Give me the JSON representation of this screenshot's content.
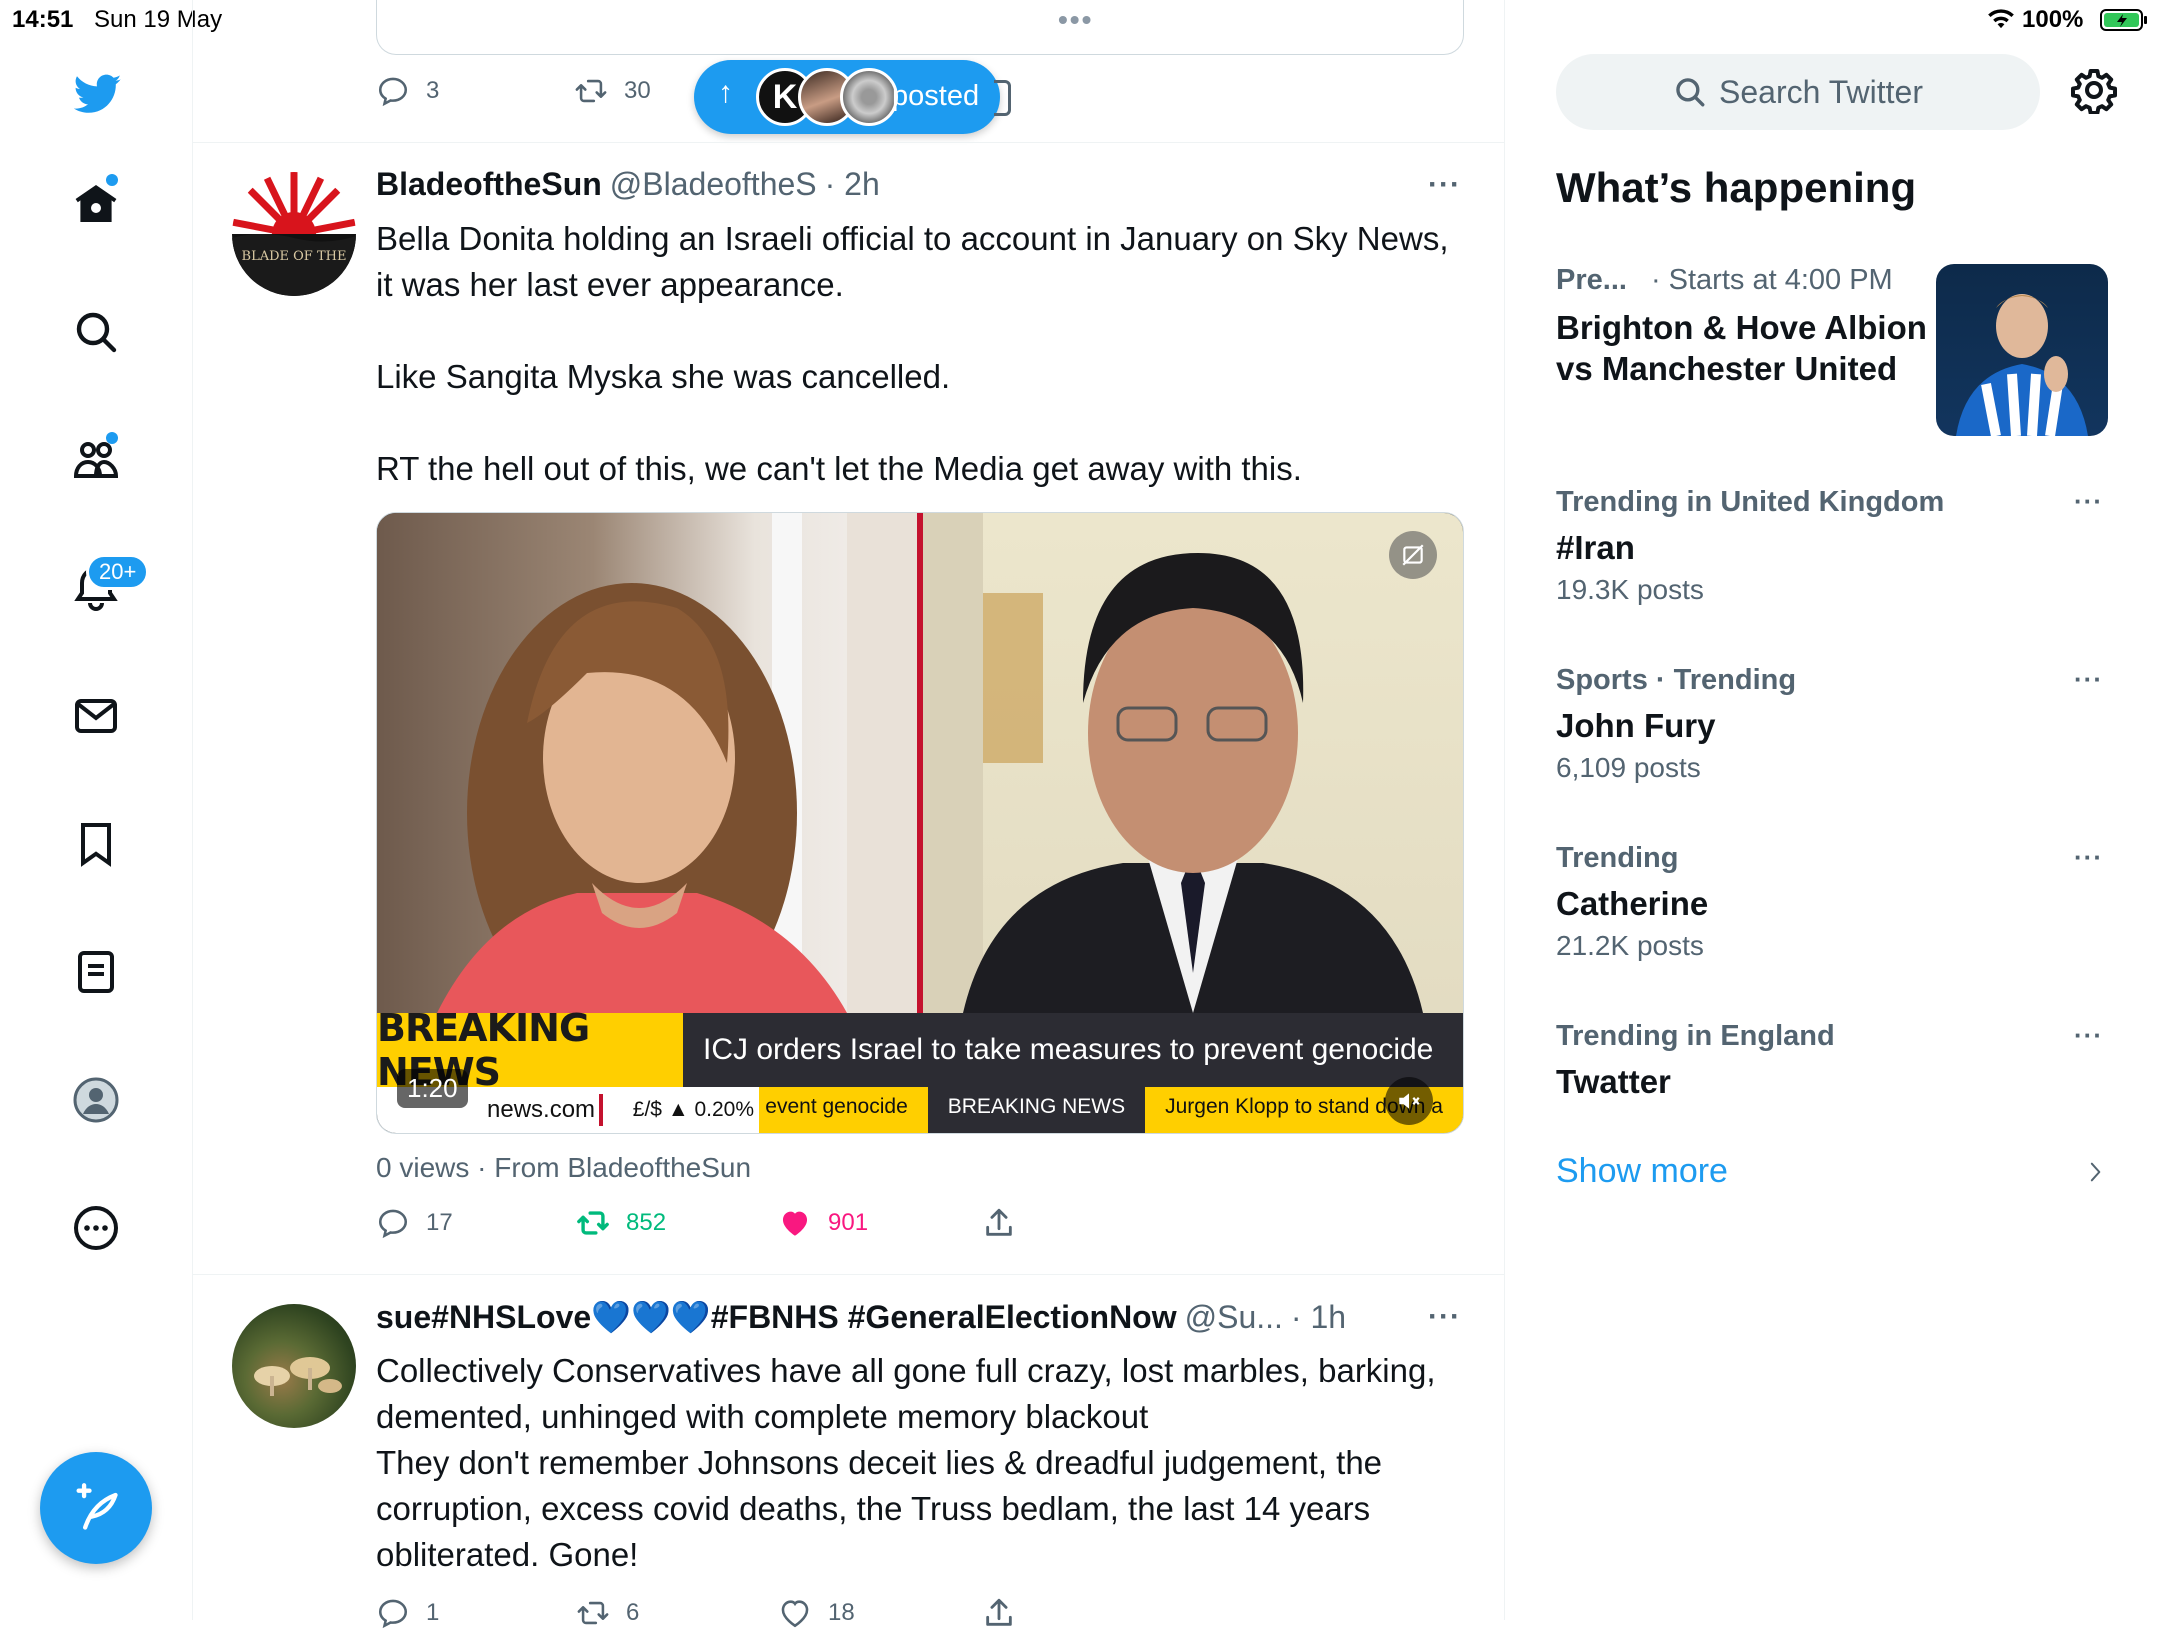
{
  "status_bar": {
    "time": "14:51",
    "date": "Sun 19 May",
    "battery": "100%"
  },
  "nav": {
    "notifications_badge": "20+"
  },
  "pill": {
    "label": "posted",
    "avatar_letter": "K"
  },
  "prev_tweet": {
    "replies": "3",
    "retweets": "30"
  },
  "tweet1": {
    "name": "BladeoftheSun",
    "handle": "@BladeoftheS",
    "time": "· 2h",
    "text": "Bella Donita holding an Israeli official to account in January on Sky News, it was her last ever appearance.\n\nLike Sangita Myska she was cancelled.\n\nRT the hell out of this, we can't let the Media get away with this.",
    "avatar_text": "BLADE OF THE",
    "video": {
      "duration": "1:20",
      "headline_tag": "BREAKING NEWS",
      "headline": "ICJ orders Israel to take measures to prevent genocide",
      "ticker_site": "news.com",
      "ticker_fx": "£/$ ▲ 0.20%",
      "ticker_1": "event genocide",
      "ticker_2": "BREAKING NEWS",
      "ticker_3": "Jurgen Klopp to stand down a"
    },
    "views": "0 views · From BladeoftheSun",
    "replies": "17",
    "retweets": "852",
    "likes": "901"
  },
  "tweet2": {
    "name": "sue#NHSLove💙💙💙#FBNHS #GeneralElectionNow",
    "handle": "@Su...",
    "time": "· 1h",
    "text": "Collectively Conservatives have all gone full crazy, lost marbles, barking, demented, unhinged with complete memory blackout\nThey don't remember Johnsons deceit lies & dreadful judgement, the corruption, excess covid deaths, the Truss bedlam, the last 14 years obliterated. Gone!",
    "replies": "1",
    "retweets": "6",
    "likes": "18"
  },
  "search": {
    "placeholder": "Search Twitter"
  },
  "sidebar": {
    "heading": "What’s happening",
    "event": {
      "meta_category": "Pre...",
      "meta_time": "· Starts at 4:00 PM",
      "title": "Brighton & Hove Albion vs Manchester United"
    },
    "trends": [
      {
        "meta": "Trending in United Kingdom",
        "title": "#Iran",
        "count": "19.3K posts"
      },
      {
        "meta": "Sports · Trending",
        "title": "John Fury",
        "count": "6,109 posts"
      },
      {
        "meta": "Trending",
        "title": "Catherine",
        "count": "21.2K posts"
      },
      {
        "meta": "Trending in England",
        "title": "Twatter",
        "count": ""
      }
    ],
    "show_more": "Show more"
  },
  "colors": {
    "accent": "#1d9bf0",
    "retweet": "#00ba7c",
    "like": "#f91880",
    "muted": "#536471"
  }
}
